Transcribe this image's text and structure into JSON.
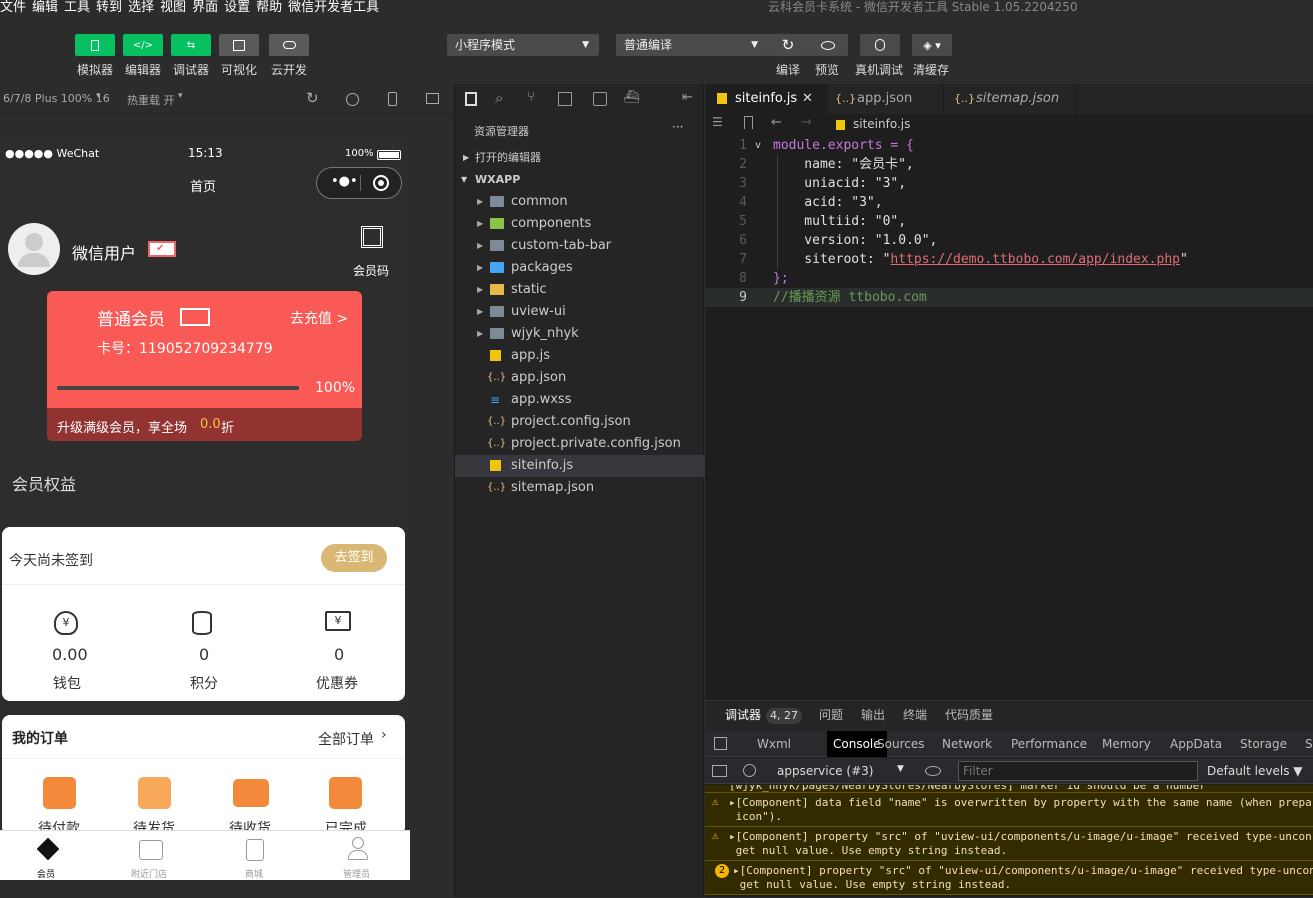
{
  "menu": [
    "文件",
    "编辑",
    "工具",
    "转到",
    "选择",
    "视图",
    "界面",
    "设置",
    "帮助",
    "微信开发者工具"
  ],
  "window_title": "云科会员卡系统 - 微信开发者工具 Stable 1.05.2204250",
  "toolbar": {
    "left_buttons": [
      {
        "label": "模拟器",
        "icon": "phone-icon",
        "color": "#07c160"
      },
      {
        "label": "编辑器",
        "icon": "code-icon",
        "color": "#07c160"
      },
      {
        "label": "调试器",
        "icon": "debug-icon",
        "color": "#07c160"
      },
      {
        "label": "可视化",
        "icon": "layout-icon",
        "color": "#5a5a5a"
      },
      {
        "label": "云开发",
        "icon": "cloud-icon",
        "color": "#5a5a5a"
      }
    ],
    "mode_select": "小程序模式",
    "compile_select": "普通编译",
    "right_buttons": [
      {
        "label": "编译",
        "icon": "refresh-icon"
      },
      {
        "label": "预览",
        "icon": "eye-icon"
      },
      {
        "label": "真机调试",
        "icon": "bug-icon"
      },
      {
        "label": "清缓存",
        "icon": "layers-icon"
      }
    ]
  },
  "simulator": {
    "device": "6/7/8 Plus 100% 16",
    "hot_reload": "热重载 开",
    "status": {
      "carrier": "●●●●● WeChat",
      "time": "15:13",
      "battery": "100%"
    },
    "nav_title": "首页",
    "user": {
      "name": "微信用户",
      "qr_label": "会员码"
    },
    "card": {
      "level": "普通会员",
      "recharge": "去充值 >",
      "card_no": "卡号：119052709234779",
      "progress": 1.0,
      "progress_text": "100%",
      "upgrade_text": "升级满级会员，享全场",
      "upgrade_discount": "0.0",
      "upgrade_suffix": "折",
      "color": "#fa5a55"
    },
    "benefits_title": "会员权益",
    "signin": {
      "text": "今天尚未签到",
      "button": "去签到"
    },
    "stats": [
      {
        "value": "0.00",
        "label": "钱包",
        "icon": "money-bag-icon"
      },
      {
        "value": "0",
        "label": "积分",
        "icon": "coins-icon"
      },
      {
        "value": "0",
        "label": "优惠券",
        "icon": "ticket-icon"
      }
    ],
    "orders": {
      "title": "我的订单",
      "all": "全部订单",
      "items": [
        "待付款",
        "待发货",
        "待收货",
        "已完成"
      ]
    },
    "tabbar": [
      "会员",
      "附近门店",
      "商城",
      "管理员"
    ]
  },
  "explorer": {
    "title": "资源管理器",
    "more": "···",
    "open_editors": "打开的编辑器",
    "root": "WXAPP",
    "folders": [
      "common",
      "components",
      "custom-tab-bar",
      "packages",
      "static",
      "uview-ui",
      "wjyk_nhyk"
    ],
    "files": [
      {
        "name": "app.js",
        "type": "js"
      },
      {
        "name": "app.json",
        "type": "json"
      },
      {
        "name": "app.wxss",
        "type": "css"
      },
      {
        "name": "project.config.json",
        "type": "json"
      },
      {
        "name": "project.private.config.json",
        "type": "json"
      },
      {
        "name": "siteinfo.js",
        "type": "js"
      },
      {
        "name": "sitemap.json",
        "type": "json"
      }
    ],
    "selected": "siteinfo.js"
  },
  "editor": {
    "tabs": [
      {
        "name": "siteinfo.js",
        "type": "js"
      },
      {
        "name": "app.json",
        "type": "json"
      },
      {
        "name": "sitemap.json",
        "type": "json"
      }
    ],
    "close": "✕",
    "breadcrumb": "siteinfo.js",
    "lines": [
      {
        "n": "1",
        "text": "module.exports = {"
      },
      {
        "n": "2",
        "text": "    name: \"会员卡\","
      },
      {
        "n": "3",
        "text": "    uniacid: \"3\","
      },
      {
        "n": "4",
        "text": "    acid: \"3\","
      },
      {
        "n": "5",
        "text": "    multiid: \"0\","
      },
      {
        "n": "6",
        "text": "    version: \"1.0.0\","
      },
      {
        "n": "7",
        "text": "    siteroot: \"https://demo.ttbobo.com/app/index.php\""
      },
      {
        "n": "8",
        "text": "};"
      },
      {
        "n": "9",
        "text": "//播播资源 ttbobo.com"
      }
    ]
  },
  "devtools": {
    "top_tabs": [
      "调试器",
      "问题",
      "输出",
      "终端",
      "代码质量"
    ],
    "badge": "4, 27",
    "panel_tabs": [
      "Wxml",
      "Console",
      "Sources",
      "Network",
      "Performance",
      "Memory",
      "AppData",
      "Storage",
      "Se"
    ],
    "context": "appservice (#3)",
    "filter_placeholder": "Filter",
    "levels": "Default levels ▼",
    "messages": [
      {
        "line1": "[wjyk_nhyk/pages/NearbyStores/NearbyStores] marker id should be a number",
        "line2": ""
      },
      {
        "line1": "▸[Component] data field \"name\" is overwritten by property with the same name (when prepa",
        "line2": " icon\")."
      },
      {
        "line1": "▸[Component] property \"src\" of \"uview-ui/components/u-image/u-image\" received type-uncon",
        "line2": " get null value. Use empty string instead."
      },
      {
        "line1": "▸[Component] property \"src\" of \"uview-ui/components/u-image/u-image\" received type-uncon",
        "line2": " get null value. Use empty string instead.",
        "count": "2"
      }
    ]
  }
}
